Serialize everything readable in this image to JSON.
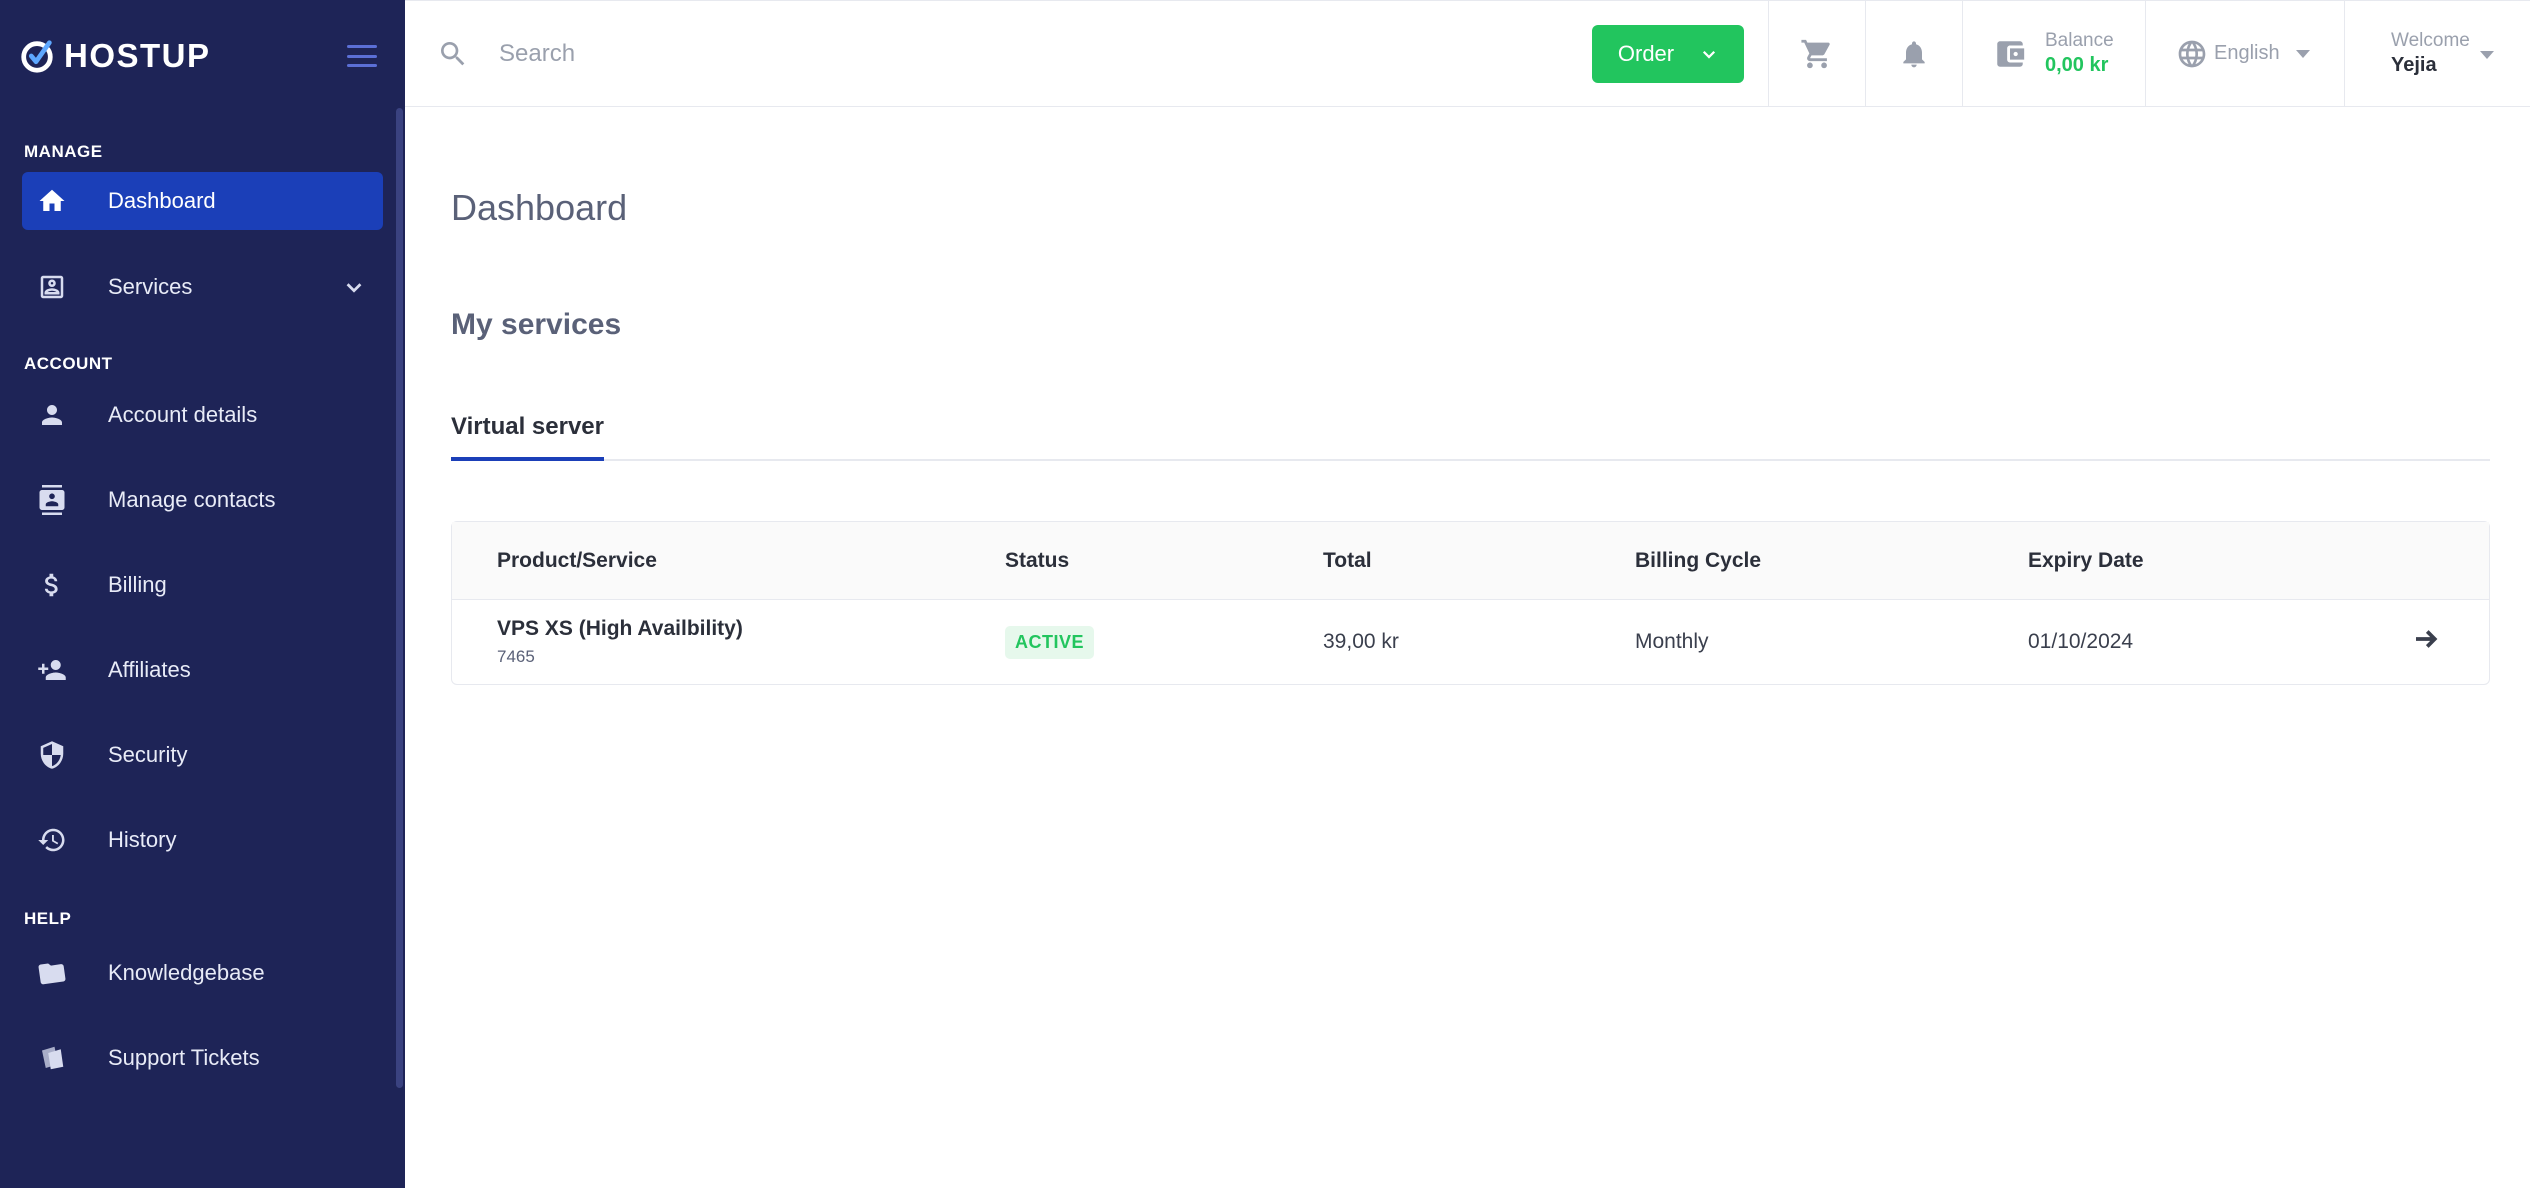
{
  "brand": {
    "name": "HOSTUP"
  },
  "sidebar": {
    "sections": [
      {
        "label": "MANAGE",
        "items": [
          {
            "label": "Dashboard",
            "icon": "home-icon",
            "active": true
          },
          {
            "label": "Services",
            "icon": "contact-card-icon",
            "has_dropdown": true
          }
        ]
      },
      {
        "label": "ACCOUNT",
        "items": [
          {
            "label": "Account details",
            "icon": "person-icon"
          },
          {
            "label": "Manage contacts",
            "icon": "contacts-icon"
          },
          {
            "label": "Billing",
            "icon": "dollar-icon"
          },
          {
            "label": "Affiliates",
            "icon": "add-person-icon"
          },
          {
            "label": "Security",
            "icon": "shield-icon"
          },
          {
            "label": "History",
            "icon": "history-icon"
          }
        ]
      },
      {
        "label": "HELP",
        "items": [
          {
            "label": "Knowledgebase",
            "icon": "folder-icon"
          },
          {
            "label": "Support Tickets",
            "icon": "tickets-icon"
          }
        ]
      }
    ]
  },
  "topbar": {
    "search_placeholder": "Search",
    "order_label": "Order",
    "balance_label": "Balance",
    "balance_value": "0,00 kr",
    "language": "English",
    "welcome_label": "Welcome",
    "user_name": "Yejia"
  },
  "main": {
    "page_title": "Dashboard",
    "section_title": "My services",
    "tabs": [
      {
        "label": "Virtual server",
        "active": true
      }
    ],
    "table": {
      "columns": [
        "Product/Service",
        "Status",
        "Total",
        "Billing Cycle",
        "Expiry Date"
      ],
      "rows": [
        {
          "product": "VPS XS (High Availbility)",
          "id": "7465",
          "status": "ACTIVE",
          "total": "39,00 kr",
          "billing_cycle": "Monthly",
          "expiry": "01/10/2024"
        }
      ]
    }
  },
  "colors": {
    "sidebar_bg": "#1e2457",
    "active_item": "#1b3fb8",
    "accent_green": "#22c55e"
  }
}
